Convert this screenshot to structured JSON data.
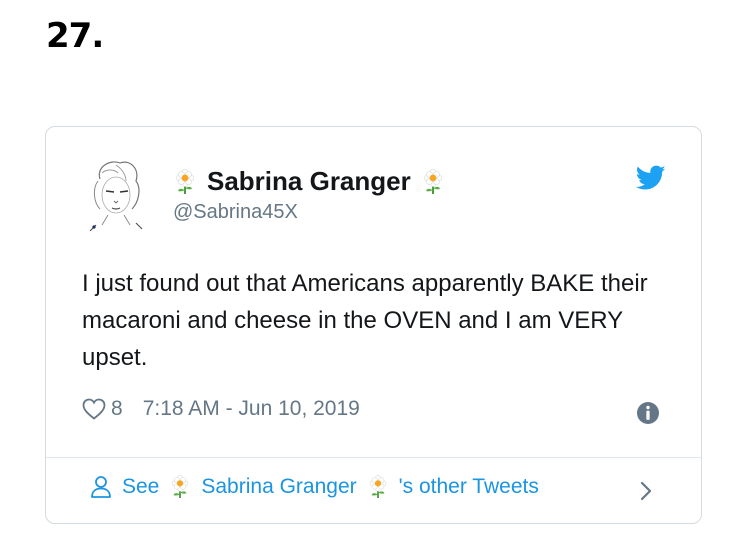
{
  "list_number": "27.",
  "tweet": {
    "author_name": "Sabrina Granger",
    "handle": "@Sabrina45X",
    "text": "I just found out that Americans apparently BAKE their macaroni and cheese in the OVEN and I am VERY upset.",
    "like_count": "8",
    "timestamp": "7:18 AM - Jun 10, 2019",
    "footer": {
      "see_label": "See",
      "author_name": "Sabrina Granger",
      "other_tweets_label": "'s other Tweets"
    }
  },
  "colors": {
    "accent": "#1b95e0",
    "twitter_blue": "#1da1f2",
    "muted": "#657786",
    "border": "#d4dbe1"
  },
  "icons": [
    "flower-emoji-icon",
    "twitter-bird-icon",
    "heart-icon",
    "info-icon",
    "user-icon",
    "chevron-right-icon"
  ]
}
